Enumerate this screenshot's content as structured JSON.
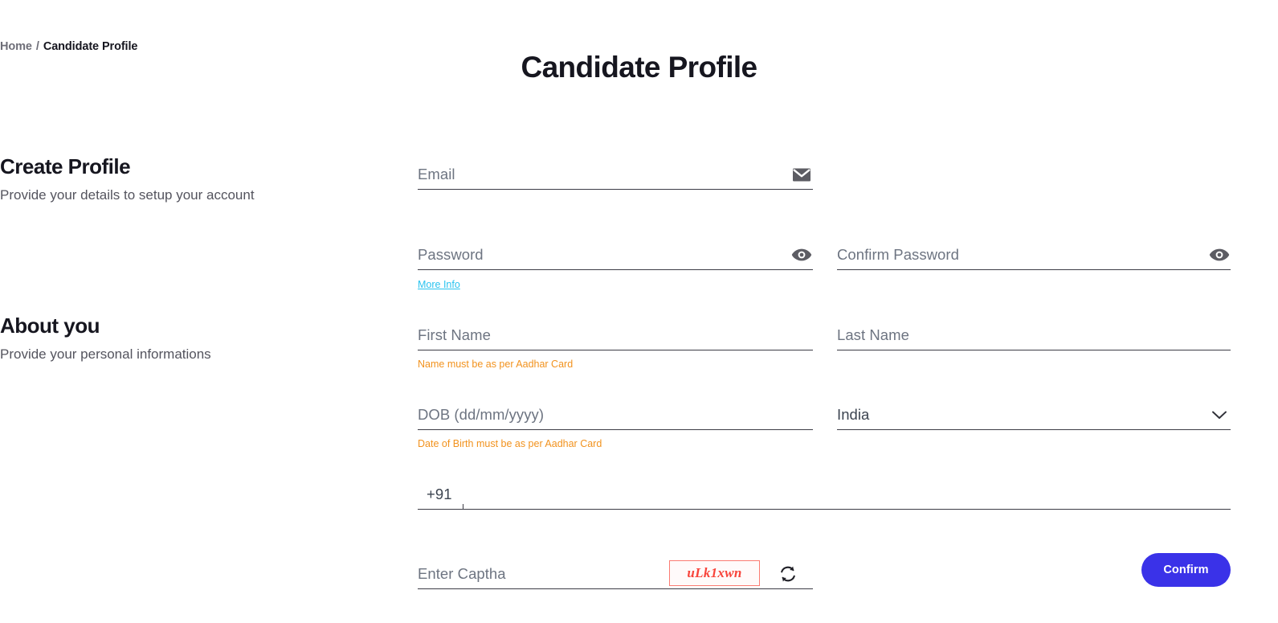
{
  "breadcrumb": {
    "home": "Home",
    "separator": "/",
    "current": "Candidate Profile"
  },
  "header": {
    "title": "Candidate Profile"
  },
  "sections": [
    {
      "title": "Create Profile",
      "subtitle": "Provide your details to setup your account"
    },
    {
      "title": "About you",
      "subtitle": "Provide your personal informations"
    }
  ],
  "form": {
    "email": {
      "label": "Email",
      "value": "",
      "icon": "envelope-icon"
    },
    "password": {
      "label": "Password",
      "value": "",
      "icon": "eye-icon",
      "more_info_link": "More Info"
    },
    "confirm_password": {
      "label": "Confirm Password",
      "value": "",
      "icon": "eye-icon"
    },
    "first_name": {
      "label": "First Name",
      "value": "",
      "helper": "Name must be as per Aadhar Card"
    },
    "last_name": {
      "label": "Last Name",
      "value": ""
    },
    "dob": {
      "label": "DOB (dd/mm/yyyy)",
      "value": "",
      "helper": "Date of Birth must be as per Aadhar Card"
    },
    "country": {
      "selected": "India",
      "icon": "chevron-down-icon",
      "options": [
        "India"
      ]
    },
    "phone": {
      "prefix": "+91",
      "value": ""
    },
    "captcha": {
      "label": "Enter Captha",
      "value": "",
      "image_text": "uLk1xwn",
      "refresh_icon": "refresh-icon"
    },
    "confirm_button": "Confirm"
  },
  "colors": {
    "accent_button": "#3a32e8",
    "helper_orange": "#f2921d",
    "link_cyan": "#29c3ef",
    "captcha_red": "#f8443b",
    "underline": "#3c3c46",
    "placeholder": "#6d7481"
  }
}
